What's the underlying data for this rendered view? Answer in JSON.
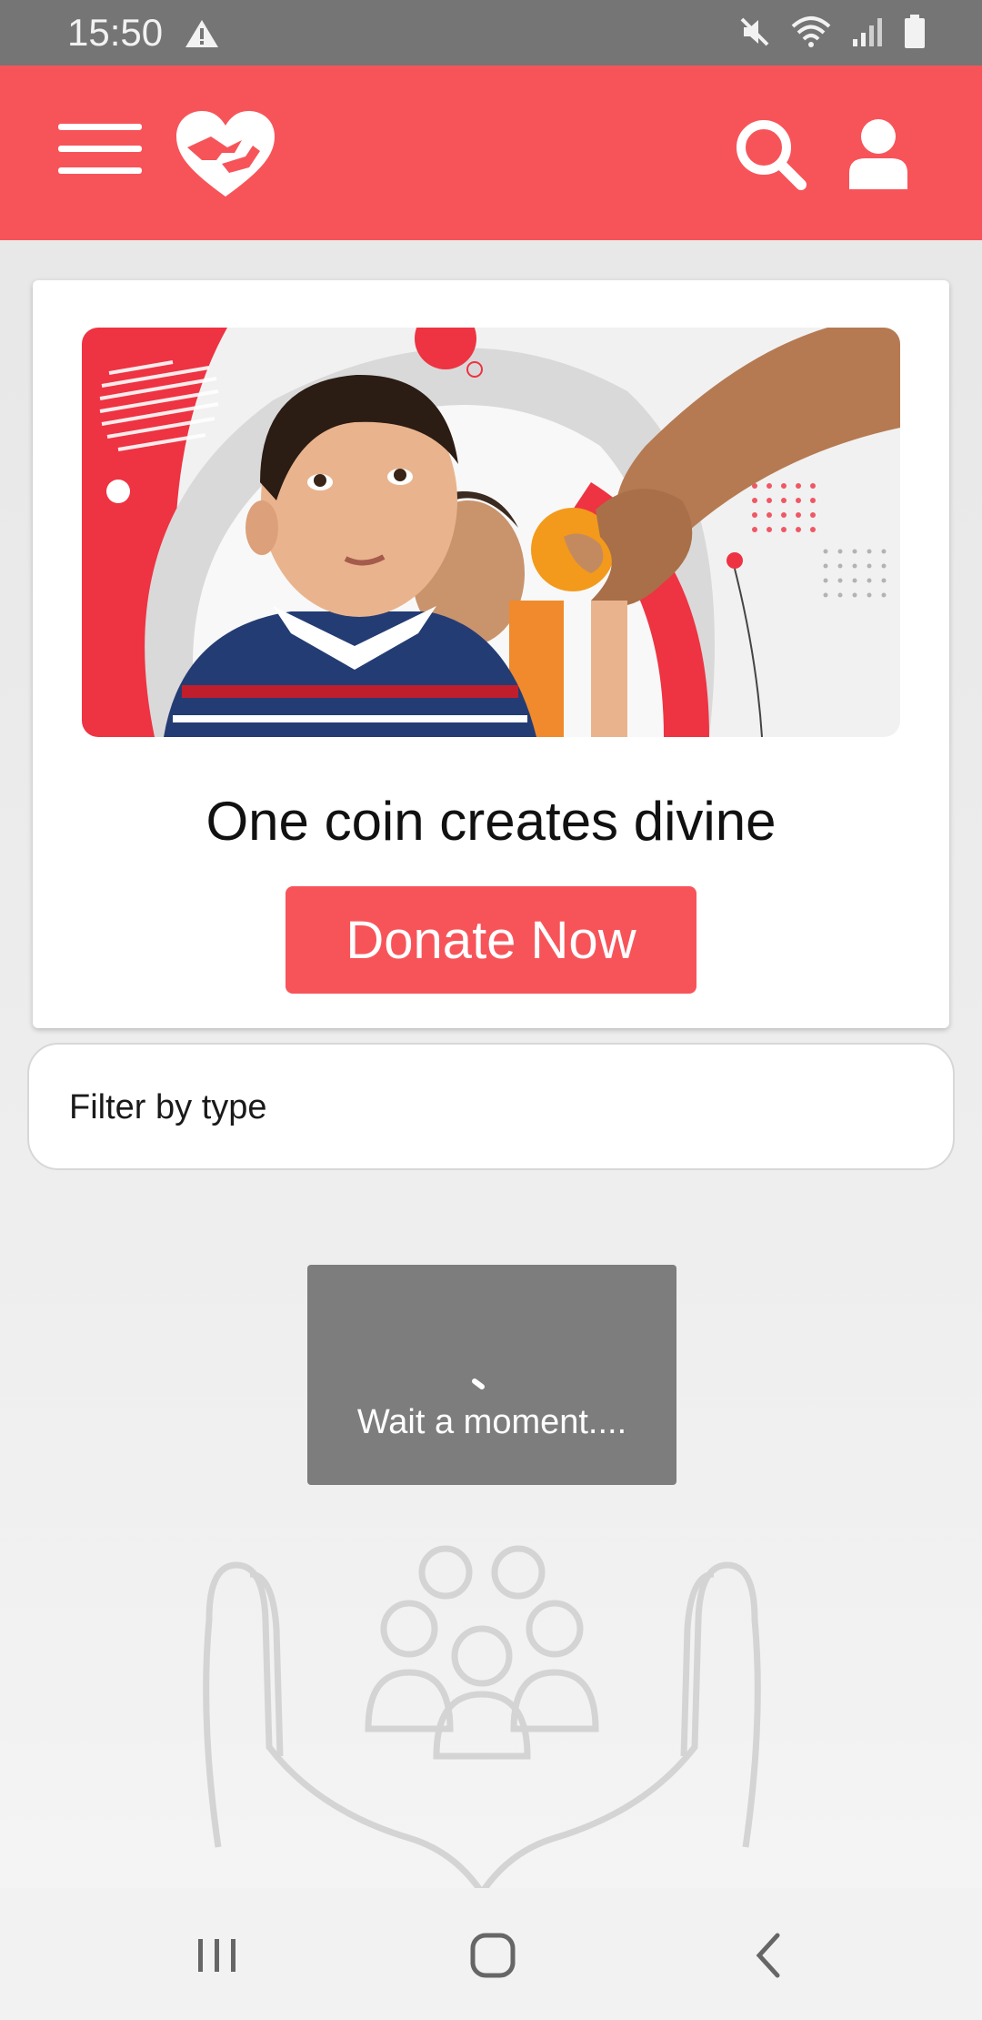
{
  "status_bar": {
    "time": "15:50",
    "icons": [
      "warning-icon",
      "mute-icon",
      "wifi-icon",
      "signal-icon",
      "battery-icon"
    ]
  },
  "app_bar": {
    "background_color": "#f7545a",
    "icons": [
      "menu-icon",
      "heart-hand-logo",
      "search-icon",
      "user-icon"
    ]
  },
  "card": {
    "title": "One coin creates divine",
    "button_label": "Donate Now"
  },
  "filter": {
    "label": "Filter by type"
  },
  "loading": {
    "text": "Wait a moment...."
  },
  "nav_bar": {
    "icons": [
      "recents-icon",
      "home-icon",
      "back-icon"
    ]
  },
  "colors": {
    "accent": "#f7545a",
    "dialog": "#7d7d7d",
    "status_bar": "#757575"
  }
}
